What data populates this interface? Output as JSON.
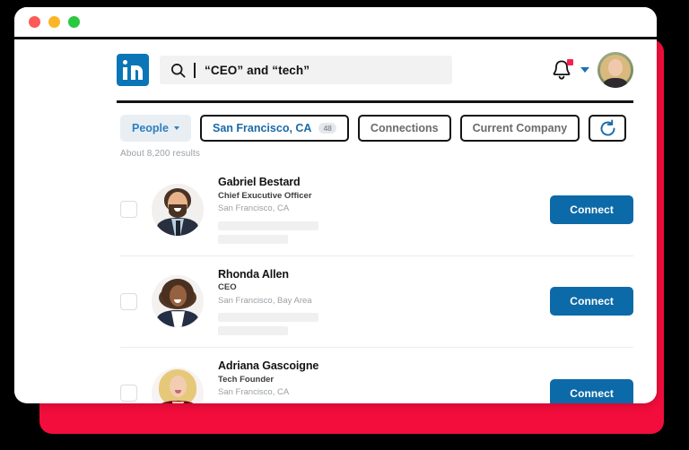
{
  "theme": {
    "accent_block_color": "#f20d3c",
    "linkedin_blue": "#0a76b7",
    "connect_button_color": "#0d6aa8",
    "link_blue": "#1a6aa8"
  },
  "window": {
    "traffic_lights": [
      {
        "name": "close",
        "color": "#fc5b57"
      },
      {
        "name": "minimize",
        "color": "#fcb527"
      },
      {
        "name": "maximize",
        "color": "#2ac940"
      }
    ]
  },
  "nav": {
    "logo_label": "in",
    "search": {
      "value": "“CEO” and “tech”",
      "placeholder": "Search",
      "icon": "search-icon"
    },
    "notifications": {
      "icon": "bell-icon",
      "has_unread": true
    },
    "account": {
      "icon": "avatar",
      "caret": "chevron-down-icon"
    }
  },
  "filters": {
    "people": {
      "label": "People",
      "caret": "chevron-down-icon"
    },
    "location": {
      "label": "San Francisco, CA",
      "count": "48"
    },
    "connections": {
      "label": "Connections"
    },
    "current_company": {
      "label": "Current Company"
    },
    "refresh": {
      "icon": "refresh-icon",
      "label": ""
    }
  },
  "results_summary": "About 8,200 results",
  "results": [
    {
      "name": "Gabriel Bestard",
      "title": "Chief Exucutive Officer",
      "location": "San Francisco, CA",
      "action_label": "Connect",
      "selected": false
    },
    {
      "name": "Rhonda Allen",
      "title": "CEO",
      "location": "San Francisco, Bay Area",
      "action_label": "Connect",
      "selected": false
    },
    {
      "name": "Adriana Gascoigne",
      "title": "Tech Founder",
      "location": "San Francisco, CA",
      "action_label": "Connect",
      "selected": false
    }
  ]
}
